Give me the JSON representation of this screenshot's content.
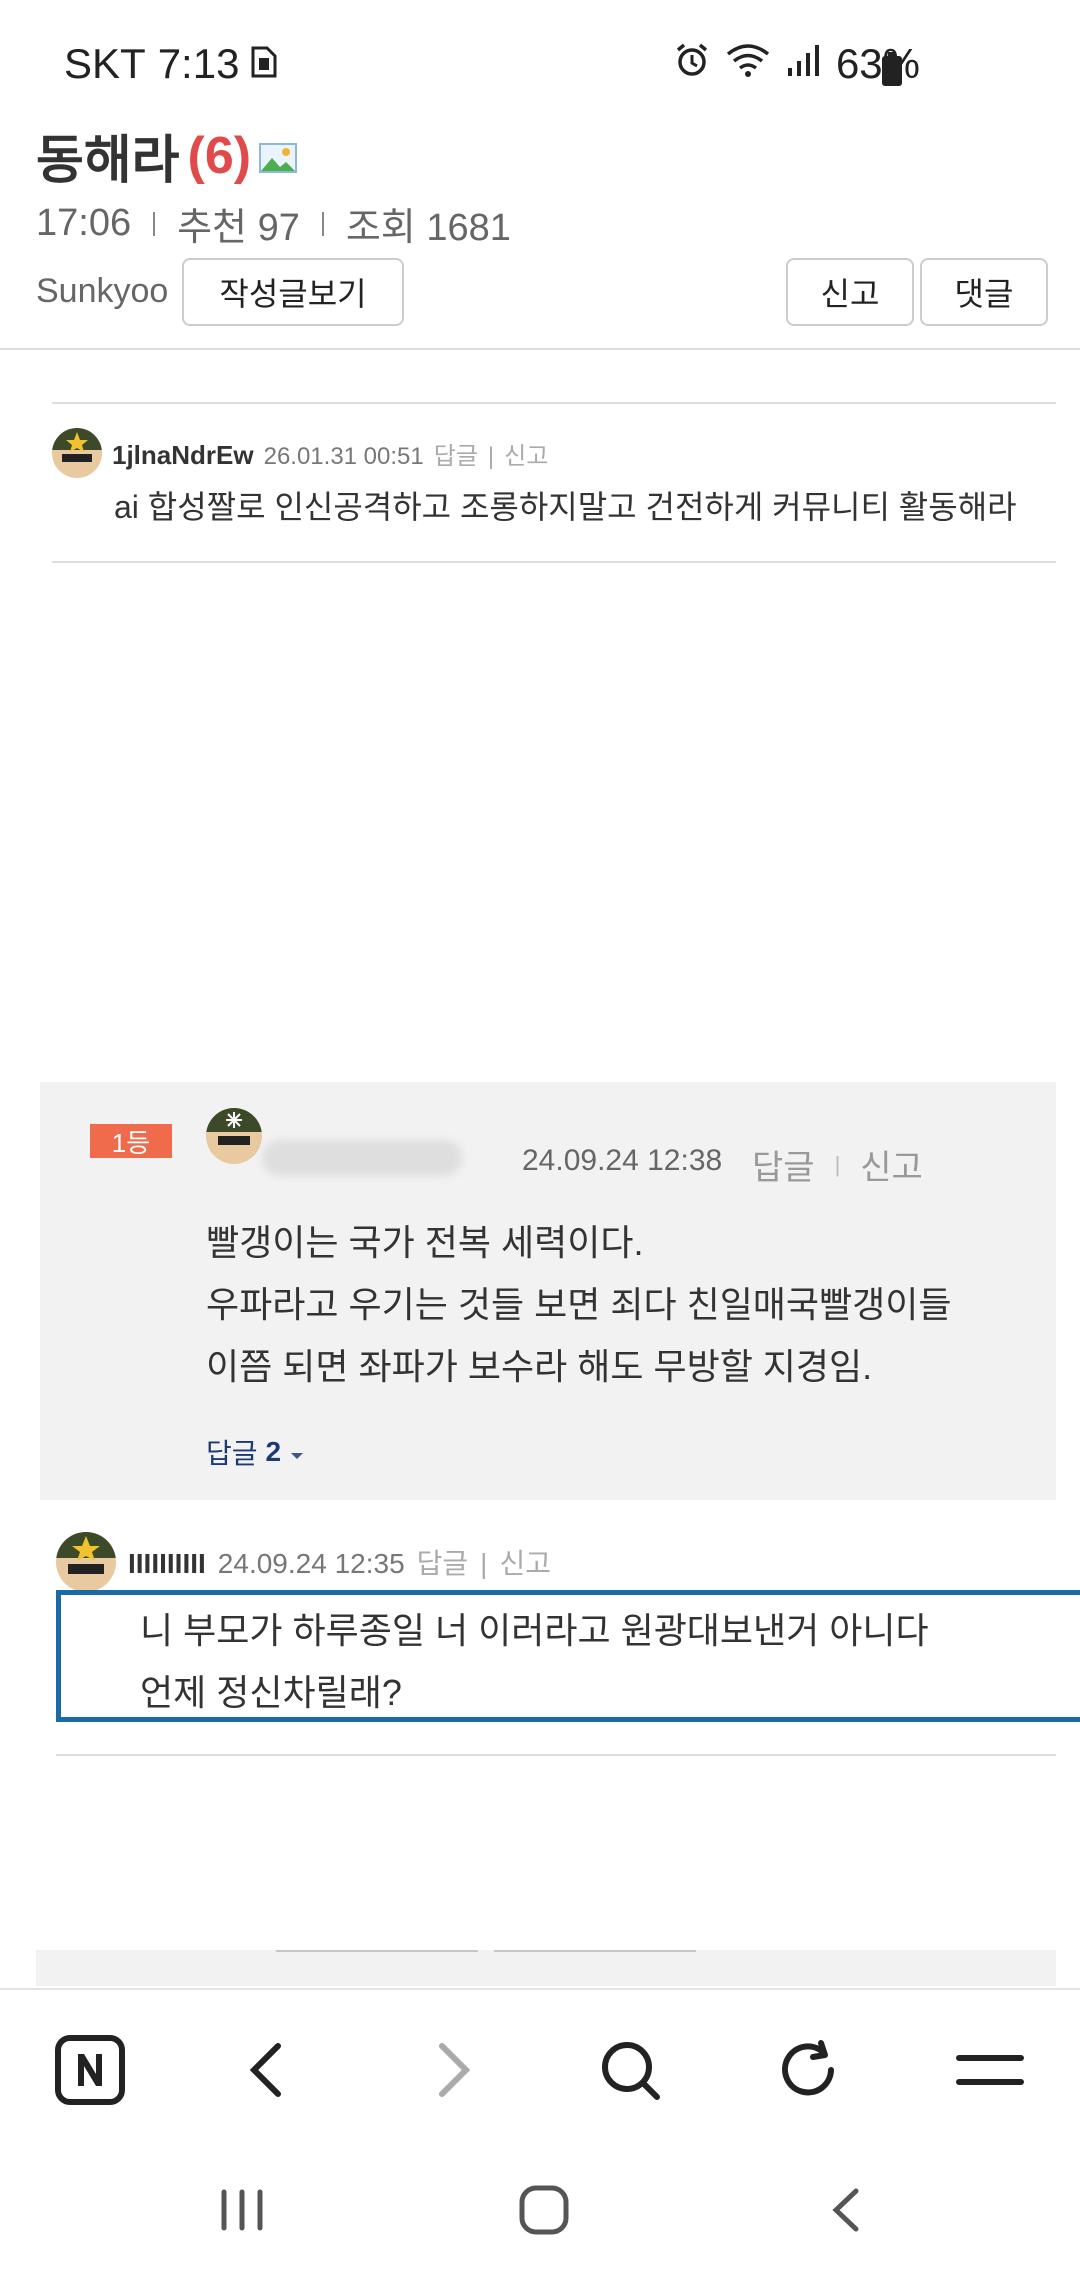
{
  "status_bar": {
    "carrier": "SKT",
    "time": "7:13",
    "battery": "63%",
    "icons": [
      "sim-card-icon",
      "alarm-icon",
      "wifi-icon",
      "signal-icon",
      "battery-icon"
    ]
  },
  "post": {
    "title": "동해라",
    "comment_count": "(6)",
    "time": "17:06",
    "recommend": "추천 97",
    "views": "조회 1681",
    "author": "Sunkyoo",
    "view_posts_button": "작성글보기",
    "report_button": "신고",
    "comment_button": "댓글"
  },
  "comments": [
    {
      "name": "1jlnaNdrEw",
      "date": "26.01.31 00:51",
      "reply_label": "답글",
      "report_label": "신고",
      "text": "ai 합성짤로 인신공격하고 조롱하지말고 건전하게 커뮤니티 활동해라"
    }
  ],
  "best_comment": {
    "rank_badge": "1등",
    "date": "24.09.24 12:38",
    "reply_label": "답글",
    "report_label": "신고",
    "lines": [
      "빨갱이는 국가 전복 세력이다.",
      "우파라고 우기는 것들 보면 죄다 친일매국빨갱이들",
      "이쯤 되면 좌파가 보수라 해도 무방할 지경임."
    ],
    "reply_count_label": "답글",
    "reply_count": "2"
  },
  "reply_comment": {
    "name": "IIIIIIIIII",
    "date": "24.09.24 12:35",
    "reply_label": "답글",
    "report_label": "신고",
    "lines": [
      "니 부모가 하루종일 너 이러라고 원광대보낸거 아니다",
      "언제 정신차릴래?"
    ]
  },
  "colors": {
    "accent_red": "#e04a4a",
    "badge": "#ef6b4b",
    "selection_border": "#1a6aa8",
    "reply_count": "#1c3a70"
  }
}
